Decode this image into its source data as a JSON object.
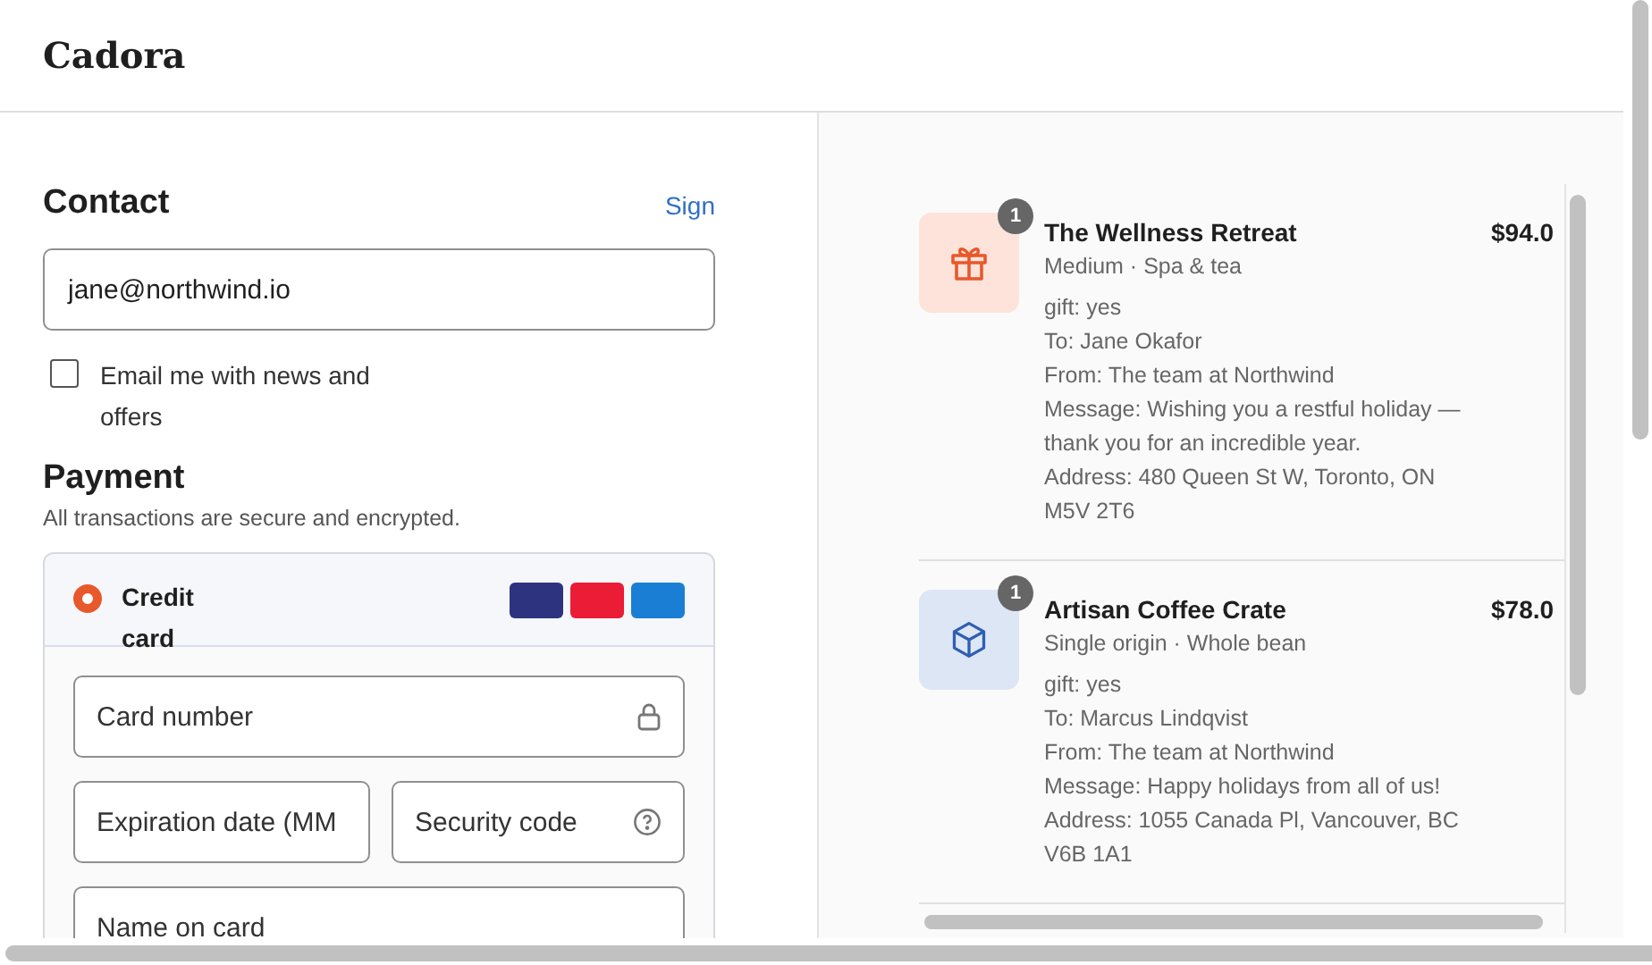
{
  "header": {
    "brand": "Cadora"
  },
  "contact": {
    "heading": "Contact",
    "sign_in_link": "Sign",
    "email": {
      "value": "jane@northwind.io"
    },
    "newsletter": {
      "label": "Email me with news and offers",
      "checked": false
    }
  },
  "payment": {
    "heading": "Payment",
    "note": "All transactions are secure and encrypted.",
    "methods": [
      {
        "label": "Credit card",
        "selected": true
      }
    ],
    "card_brands": [
      {
        "color": "#2e3380"
      },
      {
        "color": "#eb1c36"
      },
      {
        "color": "#1a7fd4"
      }
    ],
    "fields": [
      {
        "kind": "lock",
        "placeholder": "Card number"
      },
      {
        "kind": "plain",
        "placeholder": "Expiration date (MM"
      },
      {
        "kind": "help",
        "placeholder": "Security code"
      },
      {
        "kind": "plain",
        "placeholder": "Name on card"
      }
    ]
  },
  "order_items": [
    {
      "kind": "gift",
      "quantity": "1",
      "title": "The Wellness Retreat",
      "price": "$94.0",
      "subtitle": "Medium · Spa & tea",
      "details": [
        "gift: yes",
        "To: Jane Okafor",
        "From: The team at Northwind",
        "Message: Wishing you a restful holiday — thank you for an incredible year.",
        "Address: 480 Queen St W, Toronto, ON M5V 2T6"
      ]
    },
    {
      "kind": "box",
      "quantity": "1",
      "title": "Artisan Coffee Crate",
      "price": "$78.0",
      "subtitle": "Single origin · Whole bean",
      "details": [
        "gift: yes",
        "To: Marcus Lindqvist",
        "From: The team at Northwind",
        "Message: Happy holidays from all of us!",
        "Address: 1055 Canada Pl, Vancouver, BC V6B 1A1"
      ]
    }
  ]
}
